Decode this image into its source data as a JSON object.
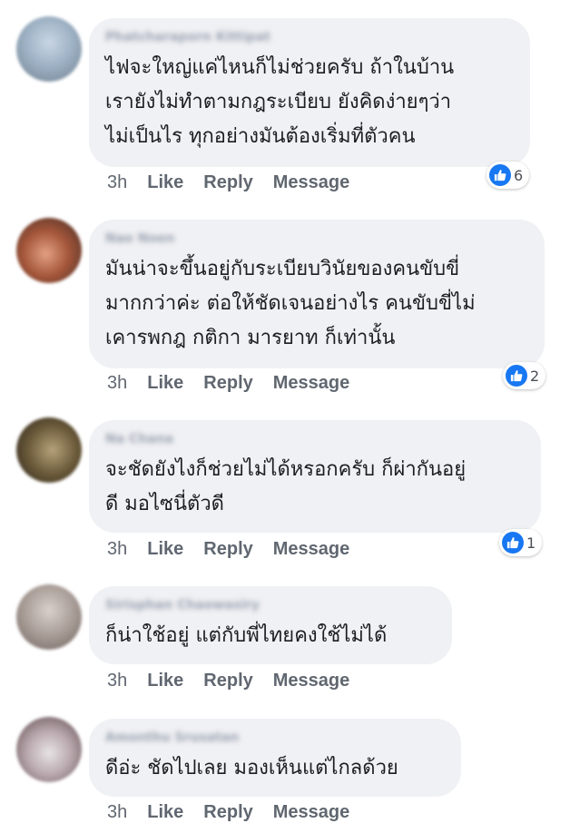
{
  "colors": {
    "bubble": "#f0f1f4",
    "like_blue": "#1877f2",
    "action_gray": "#606770"
  },
  "comments": [
    {
      "author": "Phatcharaporn Kittipat",
      "text": "ไฟจะใหญ่แค่ไหนก็ไม่ช่วยครับ ถ้าในบ้าน\nเรายังไม่ทำตามกฎระเบียบ ยังคิดง่ายๆว่า\nไม่เป็นไร ทุกอย่างมันต้องเริ่มที่ตัวคน",
      "time": "3h",
      "like": "Like",
      "reply": "Reply",
      "message": "Message",
      "reaction_icon": "like-icon",
      "reactions": "6"
    },
    {
      "author": "Nao Noen",
      "text": "มันน่าจะขึ้นอยู่กับระเบียบวินัยของคนขับขี่\nมากกว่าค่ะ ต่อให้ชัดเจนอย่างไร คนขับขี่ไม่\nเคารพกฎ กติกา มารยาท ก็เท่านั้น",
      "time": "3h",
      "like": "Like",
      "reply": "Reply",
      "message": "Message",
      "reaction_icon": "like-icon",
      "reactions": "2"
    },
    {
      "author": "Na Chana",
      "text": "จะชัดยังไงก็ช่วยไม่ได้หรอกครับ ก็ผ่ากันอยู่\nดี มอไซนี่ตัวดี",
      "time": "3h",
      "like": "Like",
      "reply": "Reply",
      "message": "Message",
      "reaction_icon": "like-icon",
      "reactions": "1"
    },
    {
      "author": "Sirisphan Chaowasiry",
      "text": "ก็น่าใช้อยู่ แต่กับพี่ไทยคงใช้ไม่ได้",
      "time": "3h",
      "like": "Like",
      "reply": "Reply",
      "message": "Message"
    },
    {
      "author": "Amonthu Srusatan",
      "text": "ดีอ่ะ ชัดไปเลย มองเห็นแต่ไกลด้วย",
      "time": "3h",
      "like": "Like",
      "reply": "Reply",
      "message": "Message"
    }
  ]
}
